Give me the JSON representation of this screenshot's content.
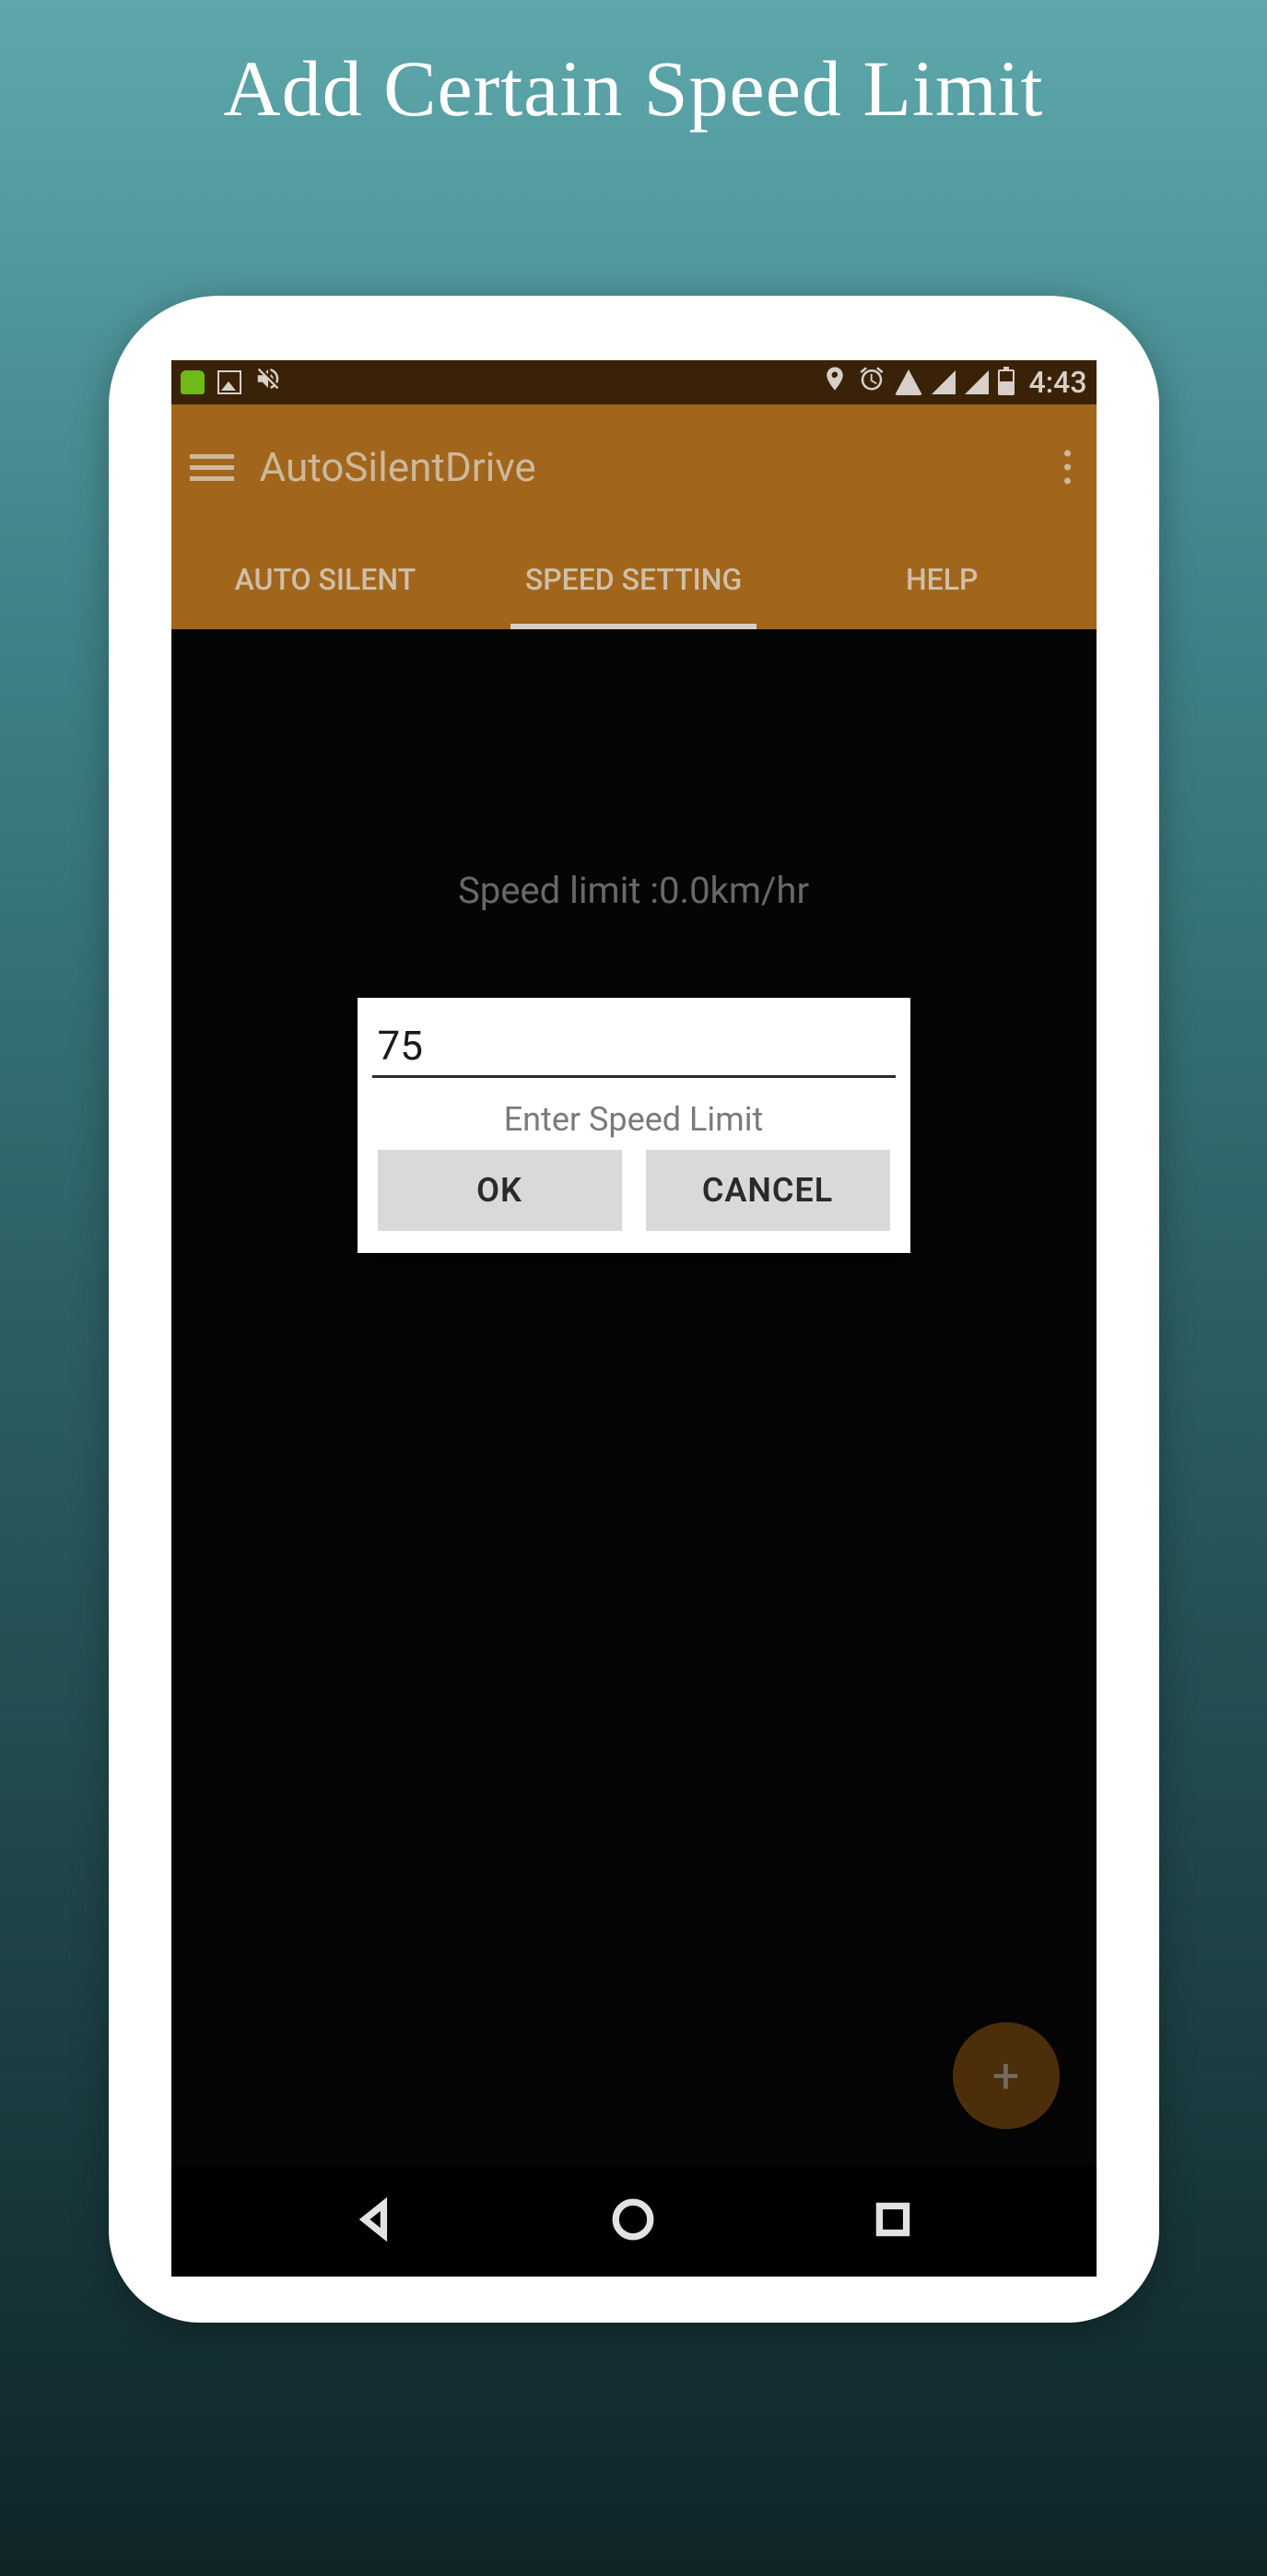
{
  "promo": {
    "title": "Add Certain Speed Limit"
  },
  "status_bar": {
    "time": "4:43",
    "icons": {
      "left": [
        "android-icon",
        "picture-icon",
        "mute-icon"
      ],
      "right": [
        "location-icon",
        "alarm-icon",
        "wifi-icon",
        "signal-icon-1",
        "signal-icon-2",
        "battery-icon"
      ]
    }
  },
  "app_bar": {
    "title": "AutoSilentDrive",
    "menu_icon": "hamburger-icon",
    "overflow_icon": "more-icon"
  },
  "tabs": [
    {
      "label": "AUTO SILENT",
      "active": false
    },
    {
      "label": "SPEED SETTING",
      "active": true
    },
    {
      "label": "HELP",
      "active": false
    }
  ],
  "content": {
    "speed_label": "Speed limit :0.0km/hr",
    "dialog": {
      "input_value": "75",
      "hint": "Enter Speed Limit",
      "ok_label": "OK",
      "cancel_label": "CANCEL"
    },
    "fab_label": "+"
  },
  "nav_bar": {
    "back_icon": "back-icon",
    "home_icon": "home-icon",
    "recent_icon": "recent-icon"
  }
}
